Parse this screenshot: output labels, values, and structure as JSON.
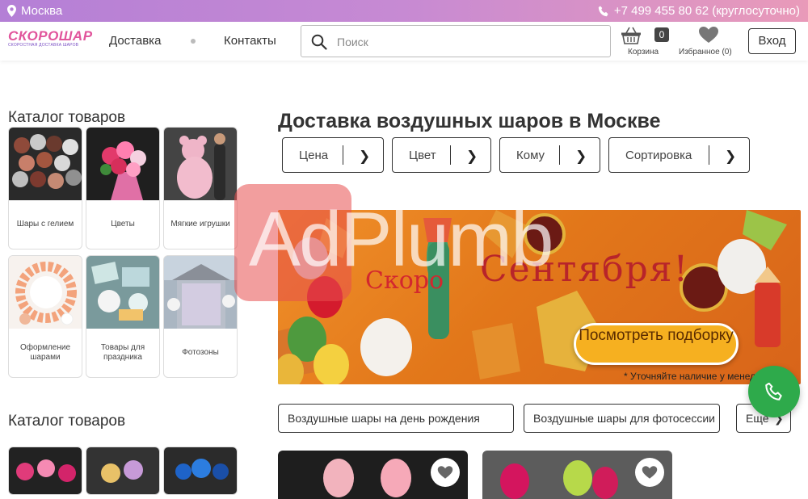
{
  "topbar": {
    "city": "Москва",
    "phone": "+7 499 455 80 62 (круглосуточно)"
  },
  "header": {
    "logo_main": "СКОРОШАР",
    "logo_sub": "СКОРОСТНАЯ ДОСТАВКА ШАРОВ",
    "nav_delivery": "Доставка",
    "nav_contacts": "Контакты",
    "search_placeholder": "Поиск",
    "cart_label": "Корзина",
    "cart_count": "0",
    "favorites_label": "Избранное (0)",
    "login_label": "Вход"
  },
  "sidebar": {
    "title1": "Каталог товаров",
    "title2": "Каталог товаров",
    "categories": [
      {
        "label": "Шары с гелием"
      },
      {
        "label": "Цветы"
      },
      {
        "label": "Мягкие игрушки"
      },
      {
        "label": "Оформление шарами"
      },
      {
        "label": "Товары для праздника"
      },
      {
        "label": "Фотозоны"
      }
    ]
  },
  "main": {
    "title": "Доставка воздушных шаров в Москве",
    "filters": [
      {
        "label": "Цена"
      },
      {
        "label": "Цвет"
      },
      {
        "label": "Кому"
      },
      {
        "label": "Сортировка"
      }
    ],
    "banner": {
      "word1": "Скоро",
      "word2": "Сентября!",
      "cta": "Посмотреть подборку",
      "note": "* Уточняйте наличие у менеджера"
    },
    "chips": [
      {
        "label": "Воздушные шары на день рождения"
      },
      {
        "label": "Воздушные шары для фотосессии"
      },
      {
        "label": "Еще"
      }
    ]
  },
  "watermark": "AdPlumb",
  "colors": {
    "accent_pink": "#e1559c",
    "accent_purple": "#b47fd6",
    "call_green": "#2eaa4b"
  }
}
